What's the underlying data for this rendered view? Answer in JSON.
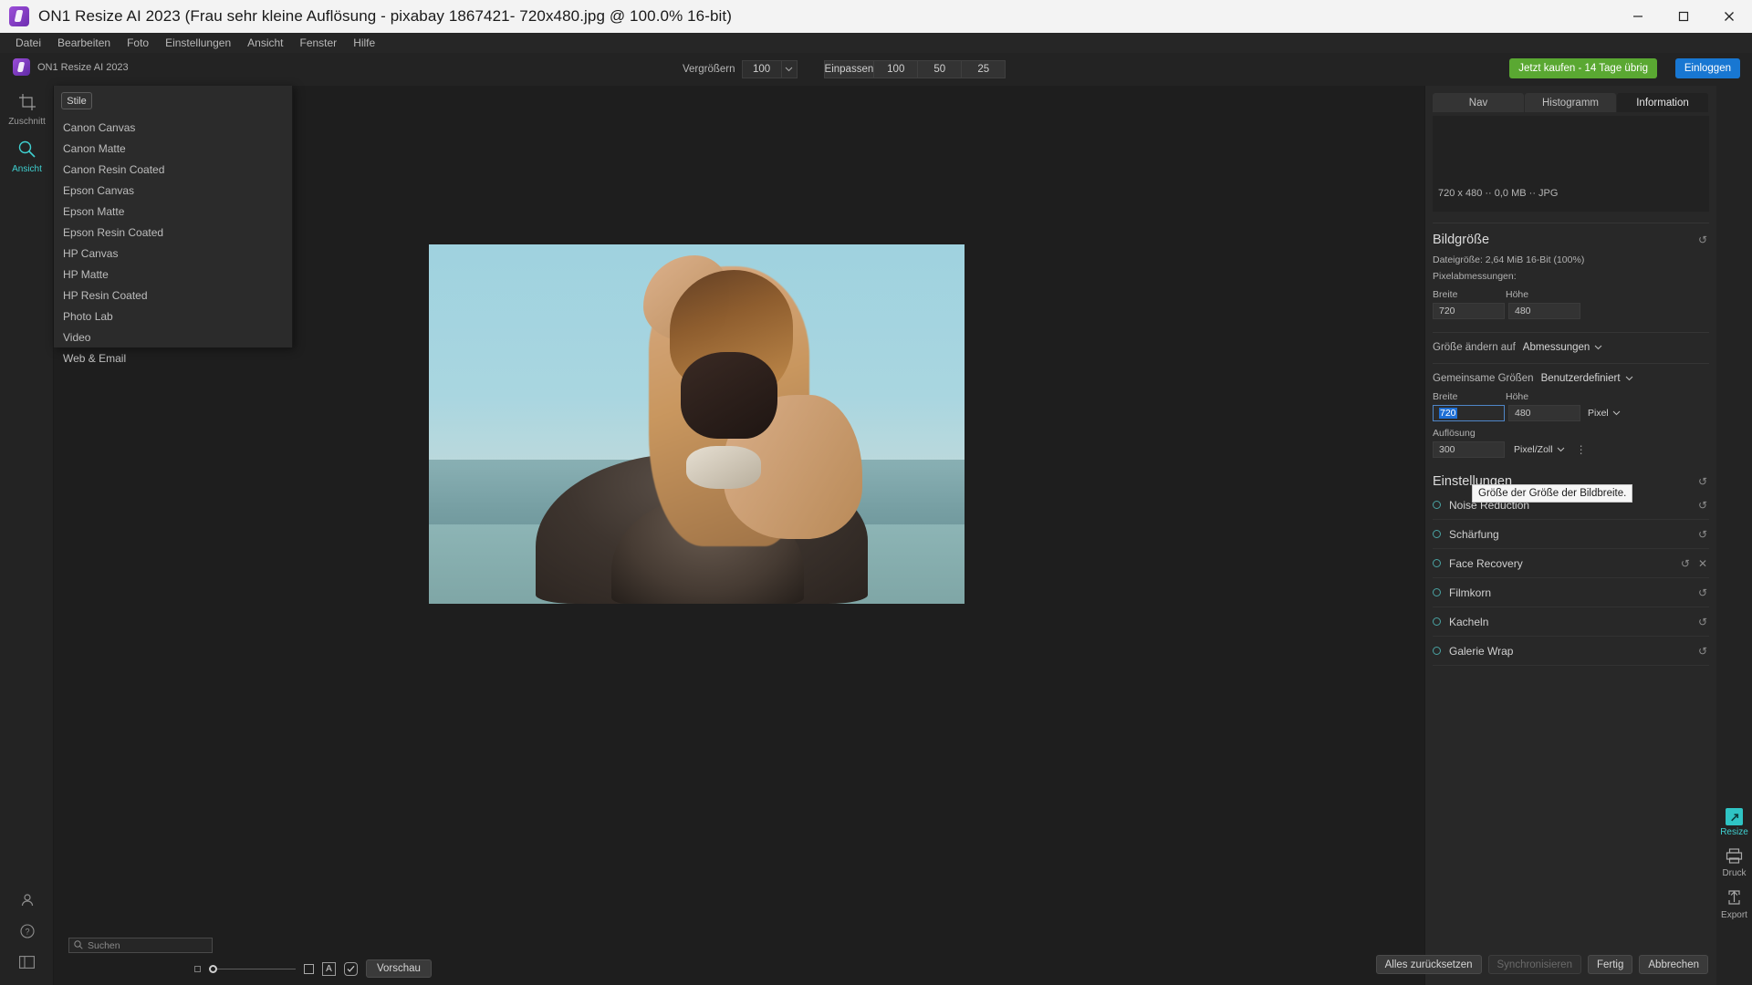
{
  "window": {
    "title": "ON1 Resize AI 2023 (Frau sehr kleine Auflösung - pixabay 1867421- 720x480.jpg @ 100.0% 16-bit)",
    "minimize": "minimize-icon",
    "maximize": "maximize-icon",
    "close": "close-icon"
  },
  "menubar": {
    "items": [
      {
        "label": "Datei"
      },
      {
        "label": "Bearbeiten"
      },
      {
        "label": "Foto"
      },
      {
        "label": "Einstellungen"
      },
      {
        "label": "Ansicht"
      },
      {
        "label": "Fenster"
      },
      {
        "label": "Hilfe"
      }
    ]
  },
  "toolbar": {
    "brand": "ON1 Resize AI 2023",
    "zoom_label": "Vergrößern",
    "zoom_value": "100",
    "fit_label": "Einpassen",
    "zoom_100": "100",
    "zoom_50": "50",
    "zoom_25": "25",
    "buy_label": "Jetzt kaufen - 14 Tage übrig",
    "login_label": "Einloggen"
  },
  "left_rail": {
    "tools": [
      {
        "label": "Zuschnitt",
        "icon": "crop-icon"
      },
      {
        "label": "Ansicht",
        "icon": "zoom-view-icon"
      }
    ],
    "bottom_icons": [
      {
        "icon": "person-icon"
      },
      {
        "icon": "help-icon"
      },
      {
        "icon": "panel-toggle-icon"
      }
    ]
  },
  "styles_panel": {
    "tab_label": "Stile",
    "items": [
      {
        "label": "Canon Canvas"
      },
      {
        "label": "Canon Matte"
      },
      {
        "label": "Canon Resin Coated"
      },
      {
        "label": "Epson Canvas"
      },
      {
        "label": "Epson Matte"
      },
      {
        "label": "Epson Resin Coated"
      },
      {
        "label": "HP Canvas"
      },
      {
        "label": "HP Matte"
      },
      {
        "label": "HP Resin Coated"
      },
      {
        "label": "Photo Lab"
      },
      {
        "label": "Video"
      },
      {
        "label": "Web & Email"
      }
    ]
  },
  "bottom_bar": {
    "search_placeholder": "Suchen",
    "preview_label": "Vorschau",
    "browser_icon": "browser-icon",
    "text_icon": "A",
    "check_icon": "checkbox-icon"
  },
  "right_panel": {
    "tabs": [
      {
        "label": "Nav",
        "active": false
      },
      {
        "label": "Histogramm",
        "active": false
      },
      {
        "label": "Information",
        "active": true
      }
    ],
    "meta": "720 x 480  ··  0,0 MB  ··  JPG",
    "image_size": {
      "title": "Bildgröße",
      "filesize": "Dateigröße: 2,64 MiB 16-Bit (100%)",
      "pixeldims": "Pixelabmessungen:",
      "width_label": "Breite",
      "height_label": "Höhe",
      "width_value": "720",
      "height_value": "480"
    },
    "resize_to": {
      "label": "Größe ändern auf",
      "value": "Abmessungen"
    },
    "common_sizes": {
      "label": "Gemeinsame Größen",
      "value": "Benutzerdefiniert",
      "width_label": "Breite",
      "height_label": "Höhe",
      "width_value": "720",
      "height_value": "480",
      "unit": "Pixel"
    },
    "resolution": {
      "label": "Auflösung",
      "value": "300",
      "unit": "Pixel/Zoll"
    },
    "tooltip": "Größe der Größe der Bildbreite.",
    "settings": {
      "title": "Einstellungen",
      "items": [
        {
          "label": "Noise Reduction",
          "has_close": false
        },
        {
          "label": "Schärfung",
          "has_close": false
        },
        {
          "label": "Face Recovery",
          "has_close": true
        },
        {
          "label": "Filmkorn",
          "has_close": false
        },
        {
          "label": "Kacheln",
          "has_close": false
        },
        {
          "label": "Galerie Wrap",
          "has_close": false
        }
      ]
    }
  },
  "far_rail": {
    "items": [
      {
        "label": "Resize",
        "icon": "ai-resize-icon",
        "active": true
      },
      {
        "label": "Druck",
        "icon": "printer-icon",
        "active": false
      },
      {
        "label": "Export",
        "icon": "export-icon",
        "active": false
      }
    ]
  },
  "footer_buttons": {
    "reset_all": "Alles zurücksetzen",
    "sync": "Synchronisieren",
    "done": "Fertig",
    "cancel": "Abbrechen"
  },
  "colors": {
    "accent": "#3fd0d0",
    "buy_green": "#5aa832",
    "login_blue": "#1877d2",
    "selection_blue": "#1f6fd4"
  }
}
